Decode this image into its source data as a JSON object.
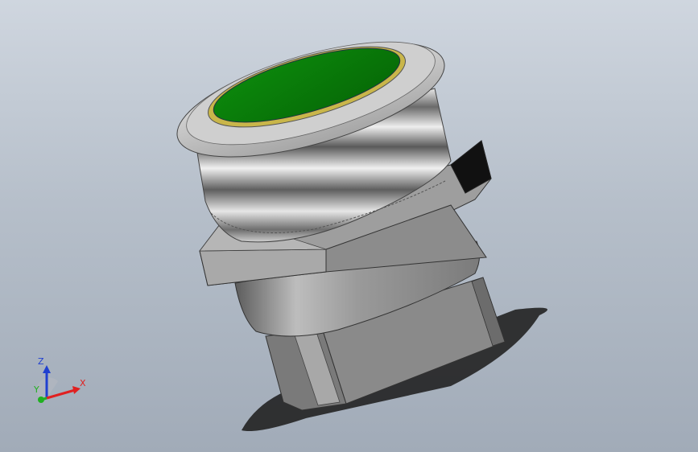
{
  "viewport": {
    "background_top": "#cfd6df",
    "background_bottom": "#a1abb8"
  },
  "model": {
    "part": "push-button-switch",
    "cap_color": "#0a7a0a",
    "bezel_ring_color": "#c9b64a",
    "body_color": "#9a9a9a",
    "nut_color": "#8f8f8f"
  },
  "triad": {
    "x_label": "X",
    "y_label": "Y",
    "z_label": "Z",
    "x_color": "#e02020",
    "y_color": "#20b020",
    "z_color": "#2040d0"
  }
}
